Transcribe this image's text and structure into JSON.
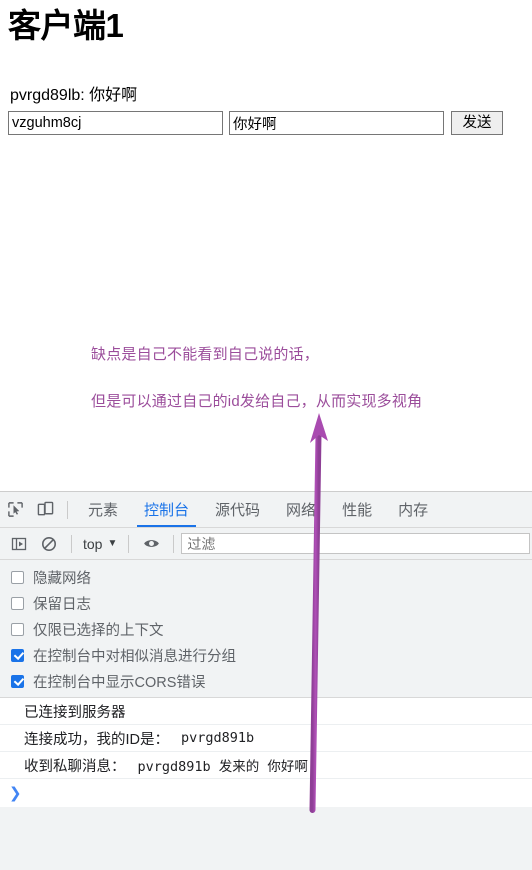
{
  "page": {
    "title": "客户端1",
    "chat_log": "pvrgd89lb: 你好啊",
    "target_input_value": "vzguhm8cj",
    "message_input_value": "你好啊",
    "send_label": "发送"
  },
  "annotation": {
    "color": "#9b4d9b",
    "line1": "缺点是自己不能看到自己说的话，",
    "line2": "但是可以通过自己的id发给自己，从而实现多视角",
    "arrow": "up-arrow"
  },
  "devtools": {
    "accent_color": "#1a73e8",
    "tabs": [
      {
        "label": "元素",
        "active": false
      },
      {
        "label": "控制台",
        "active": true
      },
      {
        "label": "源代码",
        "active": false
      },
      {
        "label": "网络",
        "active": false
      },
      {
        "label": "性能",
        "active": false
      },
      {
        "label": "内存",
        "active": false
      }
    ],
    "toolbar_icons": [
      {
        "name": "inspect-element-icon"
      },
      {
        "name": "device-toolbar-icon"
      }
    ],
    "console_toolbar": {
      "sidebar_icon": "console-sidebar-icon",
      "clear_icon": "clear-console-icon",
      "context_label": "top",
      "context_caret": "▼",
      "eye_icon": "live-expression-eye-icon",
      "filter_placeholder": "过滤",
      "filter_value": ""
    },
    "settings": [
      {
        "label": "隐藏网络",
        "checked": false
      },
      {
        "label": "保留日志",
        "checked": false
      },
      {
        "label": "仅限已选择的上下文",
        "checked": false
      },
      {
        "label": "在控制台中对相似消息进行分组",
        "checked": true
      },
      {
        "label": "在控制台中显示CORS错误",
        "checked": true
      }
    ],
    "console_messages": [
      {
        "text": "已连接到服务器",
        "mono": ""
      },
      {
        "text": "连接成功，我的ID是：",
        "mono": "pvrgd891b"
      },
      {
        "text": "收到私聊消息：",
        "mono": "pvrgd891b  发来的  你好啊"
      }
    ],
    "prompt_caret": "❯"
  }
}
